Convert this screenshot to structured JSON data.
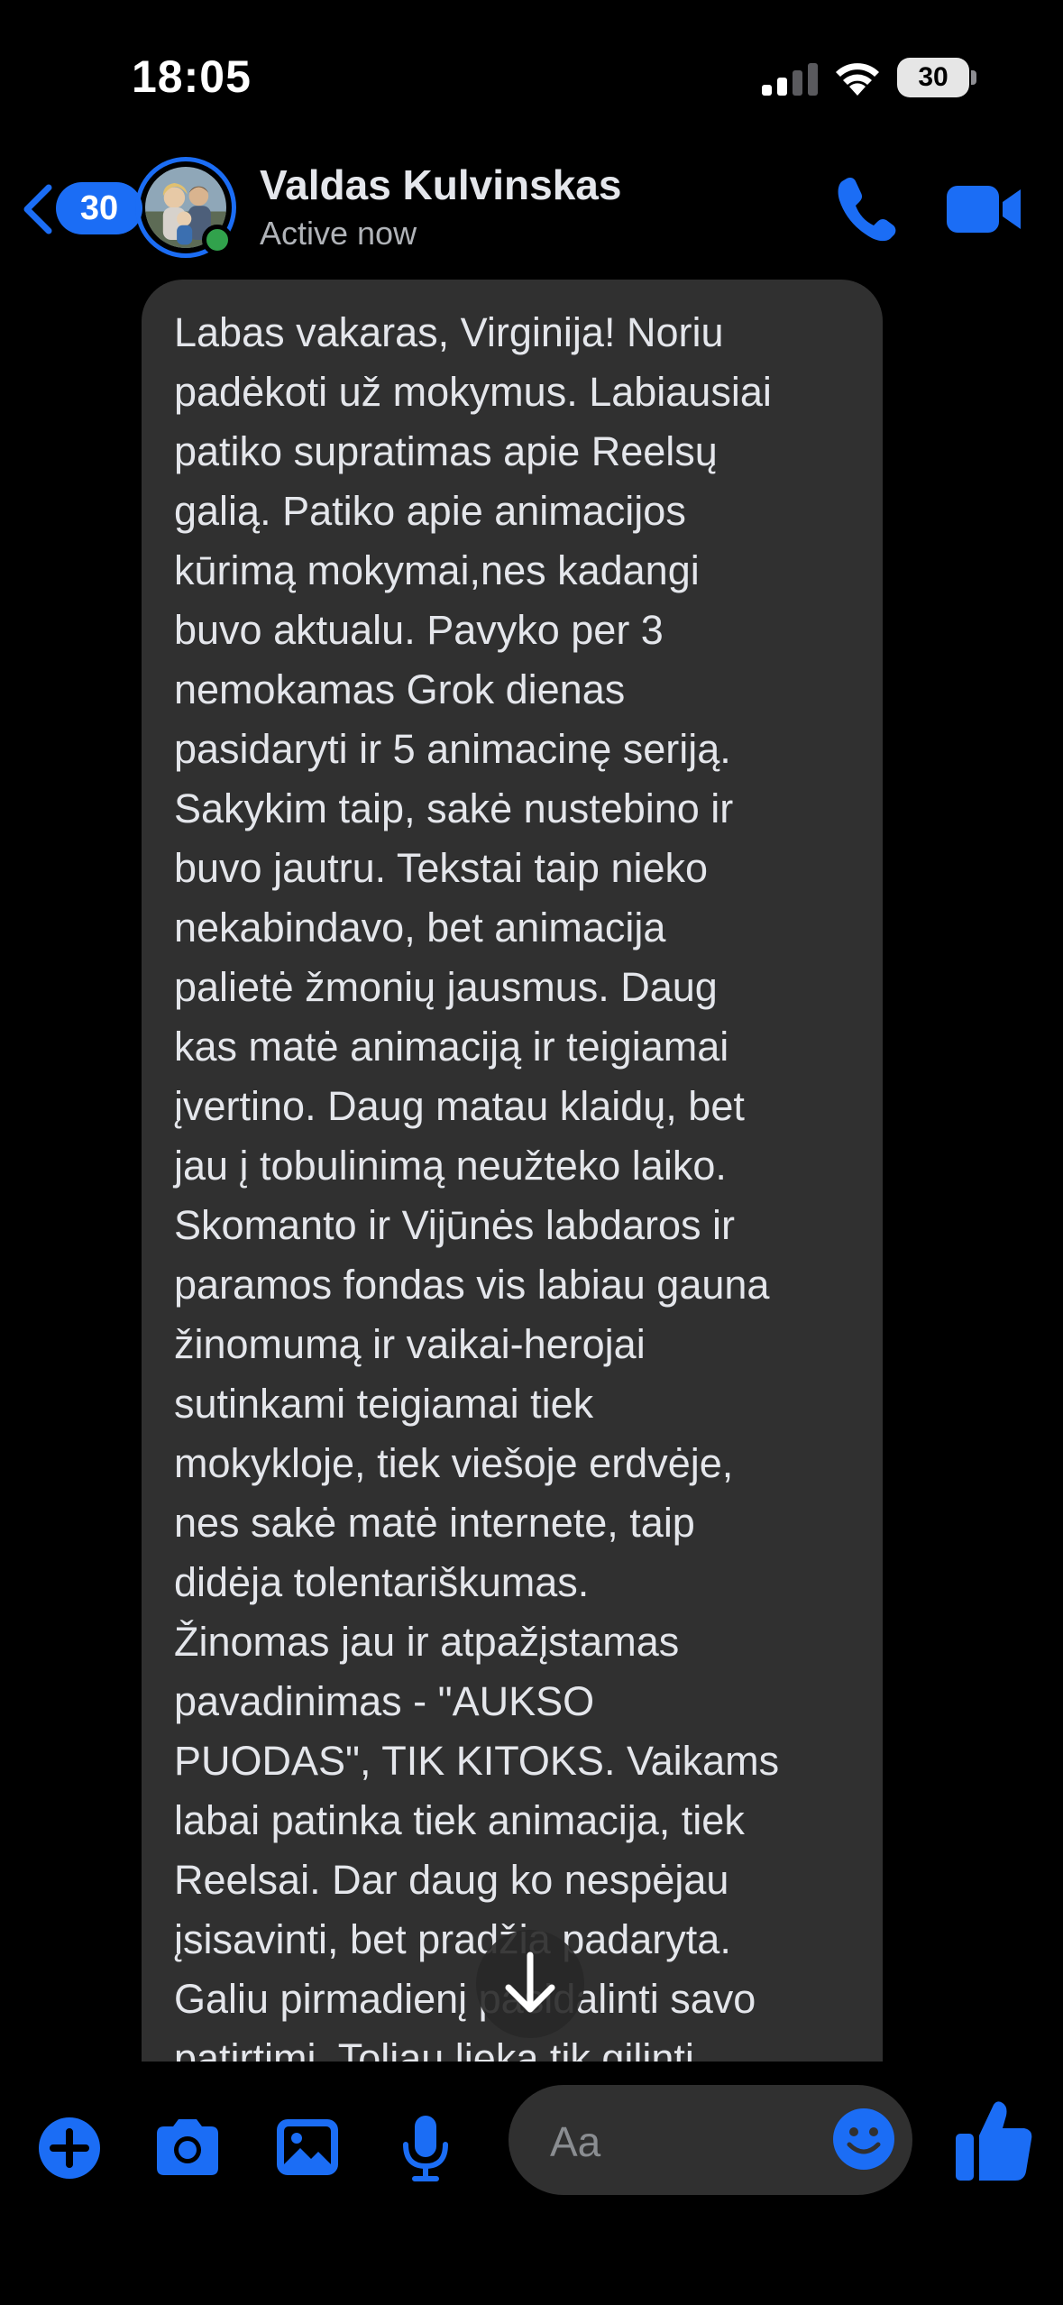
{
  "status_bar": {
    "time": "18:05",
    "battery": "30",
    "signal_icon": "cellular-signal-icon",
    "wifi_icon": "wifi-icon"
  },
  "header": {
    "back_count": "30",
    "contact_name": "Valdas Kulvinskas",
    "presence": "Active now",
    "accent_color": "#1b6df5",
    "online_color": "#31a24c"
  },
  "message": {
    "lines": [
      "Labas vakaras, Virginija! Noriu",
      "padėkoti už mokymus. Labiausiai",
      "patiko supratimas apie Reelsų",
      "galią. Patiko apie animacijos",
      "kūrimą mokymai,nes kadangi",
      "buvo aktualu. Pavyko per 3",
      "nemokamas Grok dienas",
      "pasidaryti ir 5 animacinę seriją.",
      "Sakykim taip, sakė nustebino ir",
      "buvo jautru. Tekstai taip nieko",
      "nekabindavo, bet animacija",
      "palietė žmonių jausmus. Daug",
      "kas matė animaciją ir teigiamai",
      "įvertino. Daug matau klaidų, bet",
      "jau į tobulinimą neužteko laiko.",
      "Skomanto ir Vijūnės labdaros ir",
      "paramos fondas vis labiau gauna",
      "žinomumą ir vaikai-herojai",
      "sutinkami teigiamai tiek",
      "mokykloje, tiek viešoje erdvėje,",
      "nes sakė matė internete, taip",
      "didėja tolentariškumas.",
      "Žinomas jau ir atpažįstamas",
      "pavadinimas - \"AUKSO",
      "PUODAS\", TIK KITOKS. Vaikams",
      "labai patinka tiek animacija, tiek",
      "Reelsai. Dar daug ko nespėjau",
      "įsisavinti, bet pradžia padaryta.",
      "Galiu pirmadienį pasidalinti savo",
      "patirtimi. Toliau lieka tik gilinti"
    ],
    "bubble_color": "#303030"
  },
  "composer": {
    "placeholder": "Aa",
    "icons": [
      "plus-circle-icon",
      "camera-icon",
      "gallery-icon",
      "microphone-icon",
      "emoji-icon",
      "thumbs-up-icon"
    ]
  }
}
